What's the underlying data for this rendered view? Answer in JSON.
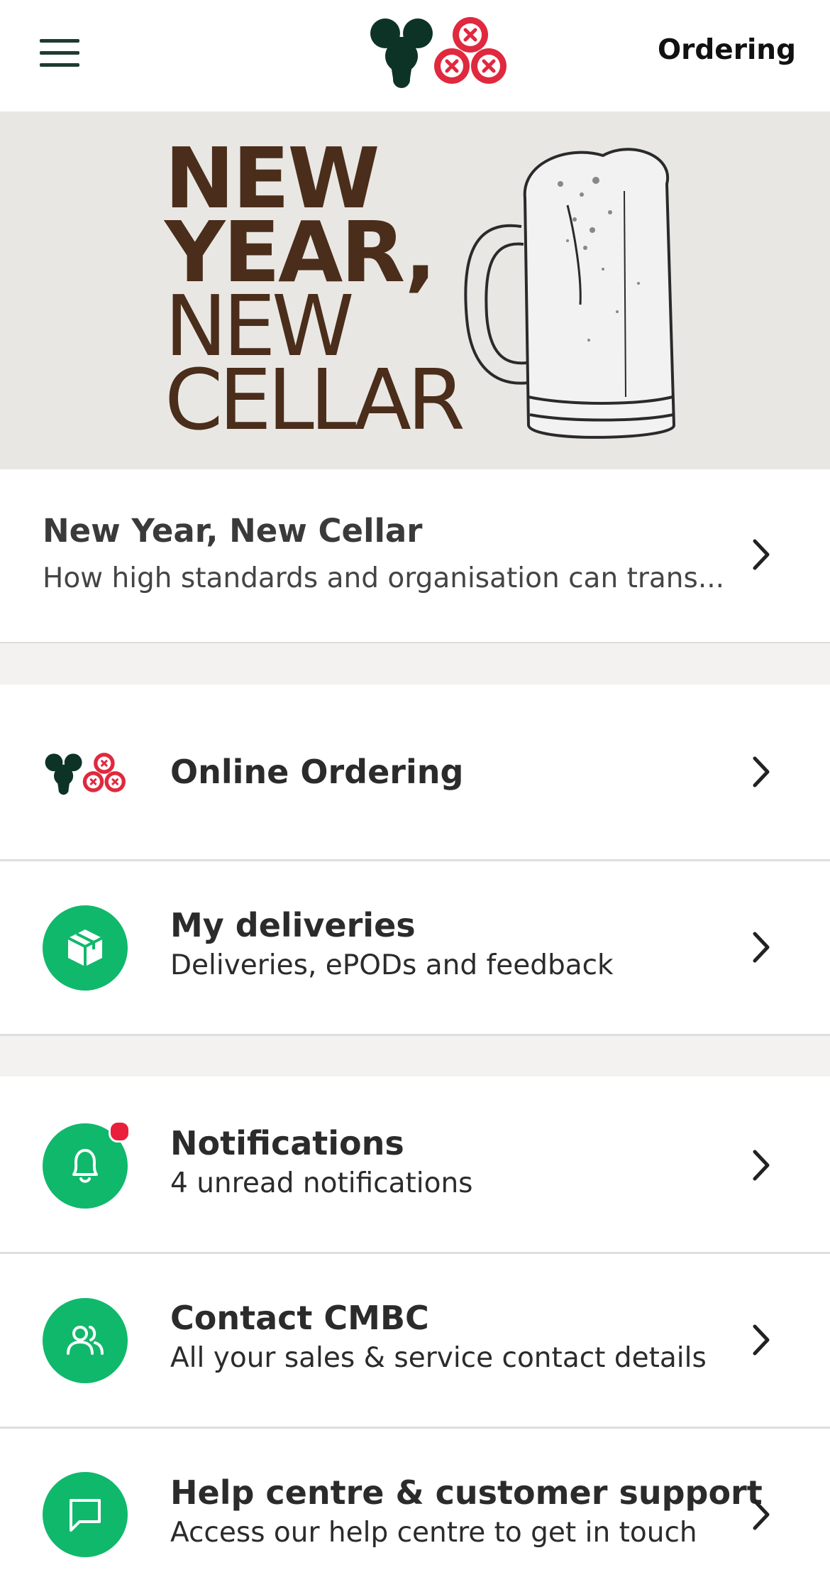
{
  "header": {
    "title": "Ordering",
    "menu_icon": "hamburger-menu-icon",
    "logo_icon": "cmbc-brand-logo"
  },
  "banner": {
    "line1": "NEW",
    "line2": "YEAR,",
    "line3": "NEW",
    "line4": "CELLAR",
    "image_icon": "beer-mug-illustration",
    "text_color": "#4a2d1a",
    "background": "#e9e7e3"
  },
  "article": {
    "title": "New Year, New Cellar",
    "subtitle": "How high standards and organisation can trans..."
  },
  "menu": {
    "online_ordering": {
      "title": "Online Ordering",
      "icon": "cmbc-logo-icon"
    },
    "deliveries": {
      "title": "My deliveries",
      "subtitle": "Deliveries, ePODs and feedback",
      "icon": "package-icon"
    },
    "notifications": {
      "title": "Notifications",
      "subtitle": "4 unread notifications",
      "icon": "bell-icon",
      "unread": true
    },
    "contact": {
      "title": "Contact CMBC",
      "subtitle": "All your sales & service contact details",
      "icon": "users-icon"
    },
    "help": {
      "title": "Help centre & customer support",
      "subtitle": "Access our help centre to get in touch",
      "icon": "chat-icon"
    }
  },
  "colors": {
    "accent_green": "#10b86b",
    "badge_red": "#ea1f3c",
    "logo_dark": "#0d3327",
    "logo_red": "#e0293e",
    "section_gap": "#f3f2f1"
  }
}
